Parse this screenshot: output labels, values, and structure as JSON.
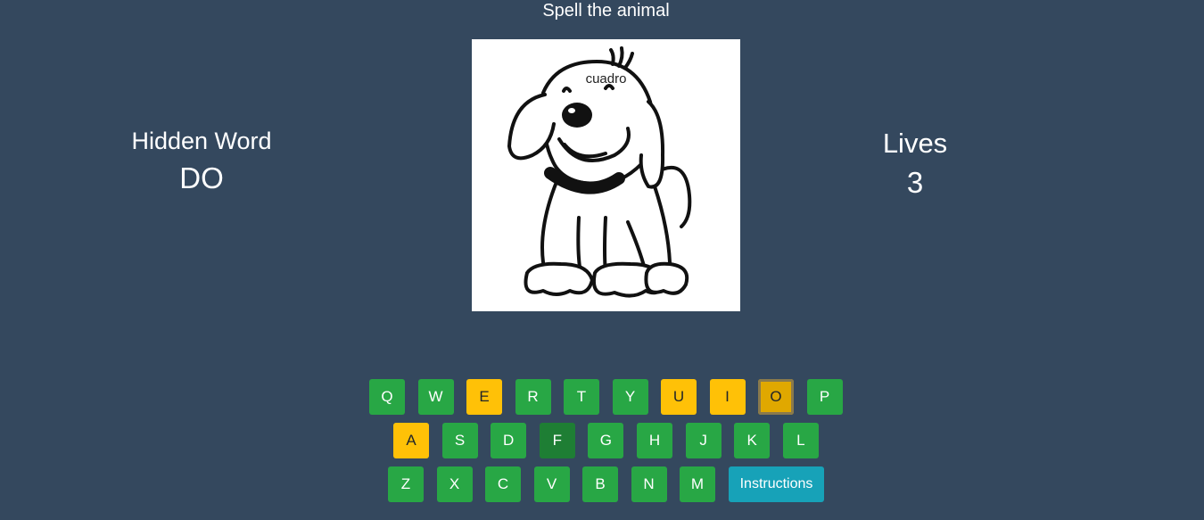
{
  "title": "Spell the animal",
  "hidden_word": {
    "label": "Hidden Word",
    "value": "DO"
  },
  "lives": {
    "label": "Lives",
    "value": "3"
  },
  "picture": {
    "caption": "cuadro",
    "subject": "cartoon-puppy"
  },
  "colors": {
    "background": "#34485e",
    "key_default": "#28a745",
    "key_used": "#ffc107",
    "key_pressed": "#1e7e34",
    "instructions": "#17a2b8"
  },
  "keyboard": {
    "row1": [
      {
        "letter": "Q",
        "state": "default"
      },
      {
        "letter": "W",
        "state": "default"
      },
      {
        "letter": "E",
        "state": "used"
      },
      {
        "letter": "R",
        "state": "default"
      },
      {
        "letter": "T",
        "state": "default"
      },
      {
        "letter": "Y",
        "state": "default"
      },
      {
        "letter": "U",
        "state": "used"
      },
      {
        "letter": "I",
        "state": "used"
      },
      {
        "letter": "O",
        "state": "active"
      },
      {
        "letter": "P",
        "state": "default"
      }
    ],
    "row2": [
      {
        "letter": "A",
        "state": "used"
      },
      {
        "letter": "S",
        "state": "default"
      },
      {
        "letter": "D",
        "state": "default"
      },
      {
        "letter": "F",
        "state": "pressed"
      },
      {
        "letter": "G",
        "state": "default"
      },
      {
        "letter": "H",
        "state": "default"
      },
      {
        "letter": "J",
        "state": "default"
      },
      {
        "letter": "K",
        "state": "default"
      },
      {
        "letter": "L",
        "state": "default"
      }
    ],
    "row3": [
      {
        "letter": "Z",
        "state": "default"
      },
      {
        "letter": "X",
        "state": "default"
      },
      {
        "letter": "C",
        "state": "default"
      },
      {
        "letter": "V",
        "state": "default"
      },
      {
        "letter": "B",
        "state": "default"
      },
      {
        "letter": "N",
        "state": "default"
      },
      {
        "letter": "M",
        "state": "default"
      }
    ],
    "instructions_label": "Instructions"
  }
}
